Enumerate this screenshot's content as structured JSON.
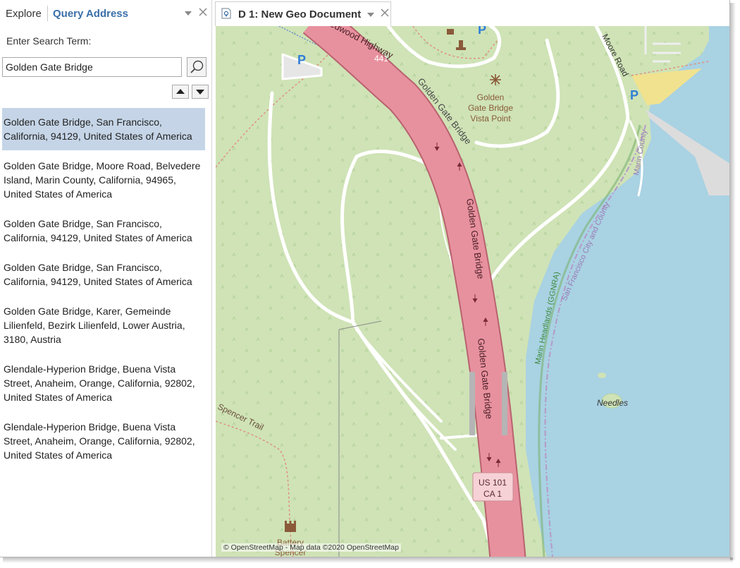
{
  "panel": {
    "tabs": {
      "explore": "Explore",
      "query": "Query Address"
    },
    "search_label": "Enter Search Term:",
    "search_value": "Golden Gate Bridge",
    "search_icon": "search-icon",
    "nav_up_icon": "triangle-up-icon",
    "nav_down_icon": "triangle-down-icon"
  },
  "results": [
    {
      "text": "Golden Gate Bridge, San Francisco, California, 94129, United States of America",
      "selected": true
    },
    {
      "text": "Golden Gate Bridge, Moore Road, Belvedere Island, Marin County, California, 94965, United States of America"
    },
    {
      "text": "Golden Gate Bridge, San Francisco, California, 94129, United States of America"
    },
    {
      "text": "Golden Gate Bridge, San Francisco, California, 94129, United States of America"
    },
    {
      "text": "Golden Gate Bridge, Karer, Gemeinde Lilienfeld, Bezirk Lilienfeld, Lower Austria, 3180, Austria"
    },
    {
      "text": "Glendale-Hyperion Bridge, Buena Vista Street, Anaheim, Orange, California, 92802, United States of America"
    },
    {
      "text": "Glendale-Hyperion Bridge, Buena Vista Street, Anaheim, Orange, California, 92802, United States of America"
    }
  ],
  "document": {
    "tab_title": "D 1: New Geo Document",
    "icon": "geo-document-icon"
  },
  "map": {
    "labels": {
      "highway_north": "Redwood Highway",
      "route_441": "441",
      "bridge_1": "Golden Gate Bridge",
      "bridge_2": "Golden Gate Bridge",
      "bridge_3": "Golden Gate Bridge",
      "vista_point": [
        "Golden",
        "Gate Bridge",
        "Vista Point"
      ],
      "moore_road": "Moore Road",
      "marin_county": "Marin County",
      "sf_marin": "San Francisco City and County",
      "marin_headlands": "Marin Headlands (GGNRA)",
      "needles": "Needles",
      "spencer_trail": "Spencer Trail",
      "battery_spencer": [
        "Battery",
        "Spencer"
      ],
      "shield": [
        "US 101",
        "CA 1"
      ],
      "parking": "P"
    },
    "attribution": "© OpenStreetMap - Map data ©2020 OpenStreetMap",
    "colors": {
      "land": "#cfe3b6",
      "water": "#a9d2e3",
      "motorway": "#e8919e",
      "motorway_casing": "#b8626f",
      "path": "#ffffff",
      "trail": "#e09080",
      "beach": "#f1e28f",
      "label": "#6b4d3a",
      "park_label": "#3e8a3e"
    }
  }
}
